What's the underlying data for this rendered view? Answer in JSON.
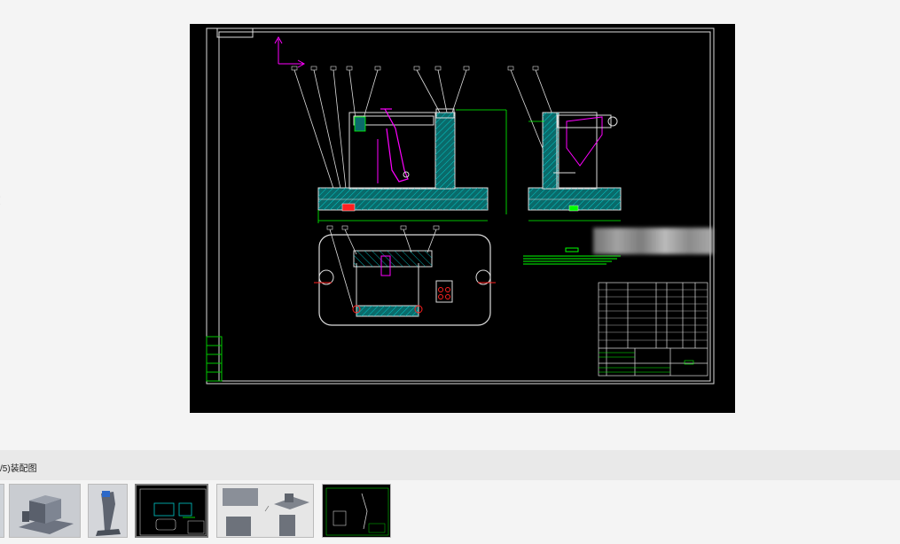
{
  "viewer": {
    "caption": "/5)装配图",
    "prev_arrow_glyph": "‹"
  },
  "thumbnails": [
    {
      "name": "thumb-3d-base",
      "active": false
    },
    {
      "name": "thumb-3d-lever",
      "active": false
    },
    {
      "name": "thumb-assembly-drawing",
      "active": true
    },
    {
      "name": "thumb-three-views",
      "active": false
    },
    {
      "name": "thumb-part-drawing",
      "active": false
    }
  ],
  "colors": {
    "cad_background": "#000000",
    "cad_white": "#ffffff",
    "cad_cyan": "#00c8c8",
    "cad_green": "#00ff00",
    "cad_magenta": "#ff00ff",
    "cad_red": "#ff2020"
  }
}
